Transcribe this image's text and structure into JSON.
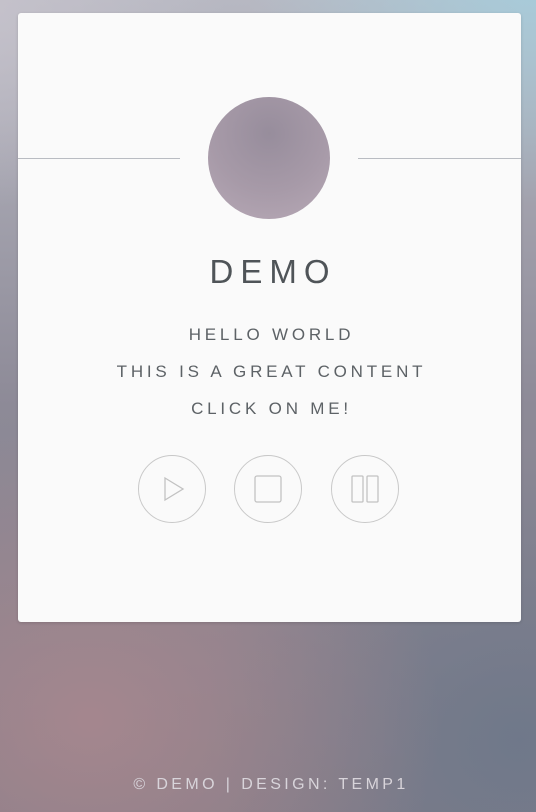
{
  "card": {
    "title": "DEMO",
    "lines": [
      "HELLO WORLD",
      "THIS IS A GREAT CONTENT",
      "CLICK ON ME!"
    ]
  },
  "controls": [
    {
      "name": "play",
      "icon": "play-icon"
    },
    {
      "name": "stop",
      "icon": "stop-icon"
    },
    {
      "name": "pause",
      "icon": "pause-icon"
    }
  ],
  "footer": {
    "text": "© DEMO | DESIGN: TEMP1"
  },
  "colors": {
    "card_background": "#fafafa",
    "title_text": "#4f5458",
    "control_border": "#c8c8c8",
    "footer_text": "#d8d4da"
  }
}
